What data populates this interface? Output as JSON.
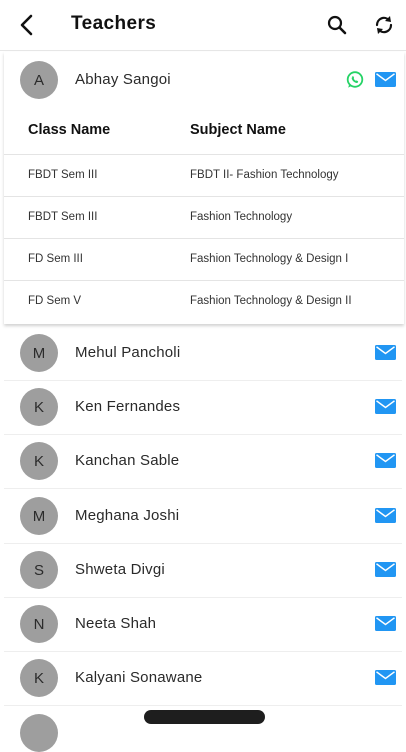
{
  "header": {
    "title": "Teachers",
    "back_icon": "back-arrow-icon",
    "search_icon": "search-icon",
    "refresh_icon": "refresh-icon"
  },
  "expanded_teacher": {
    "initial": "A",
    "name": "Abhay Sangoi",
    "table": {
      "headers": [
        "Class Name",
        "Subject Name"
      ],
      "rows": [
        {
          "class": "FBDT Sem III",
          "subject": "FBDT II- Fashion Technology"
        },
        {
          "class": "FBDT Sem III",
          "subject": "Fashion Technology"
        },
        {
          "class": "FD Sem III",
          "subject": "Fashion Technology & Design I"
        },
        {
          "class": "FD Sem V",
          "subject": "Fashion Technology & Design II"
        }
      ]
    }
  },
  "teachers": [
    {
      "initial": "M",
      "name": "Mehul Pancholi"
    },
    {
      "initial": "K",
      "name": "Ken Fernandes"
    },
    {
      "initial": "K",
      "name": "Kanchan Sable"
    },
    {
      "initial": "M",
      "name": "Meghana Joshi"
    },
    {
      "initial": "S",
      "name": "Shweta Divgi"
    },
    {
      "initial": "N",
      "name": "Neeta Shah"
    },
    {
      "initial": "K",
      "name": "Kalyani Sonawane"
    }
  ],
  "colors": {
    "mail": "#2196f3",
    "whatsapp": "#25d366",
    "avatar": "#9e9e9e"
  }
}
